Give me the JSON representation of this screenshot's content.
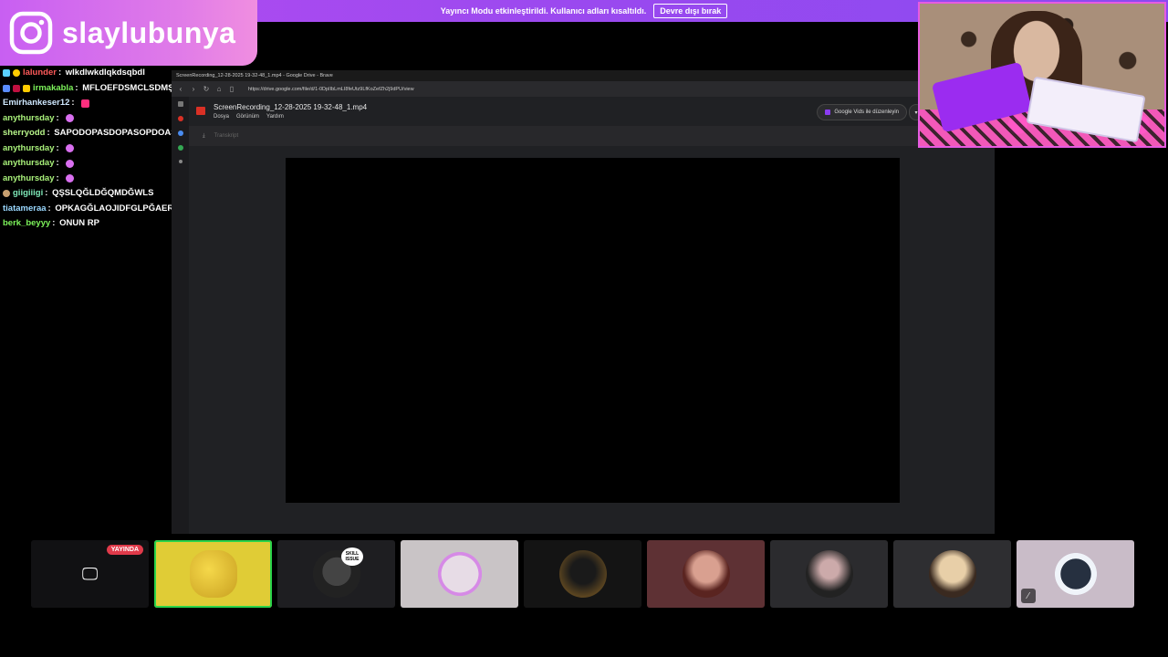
{
  "banner": {
    "message": "Yayıncı Modu etkinleştirildi. Kullanıcı adları kısaltıldı.",
    "disable_label": "Devre dışı bırak"
  },
  "overlay": {
    "instagram_handle": "slaylubunya",
    "icon": "instagram-icon"
  },
  "chat": {
    "messages": [
      {
        "user": "lalunder",
        "text": "wlkdlwkdlqkdsqbdl",
        "user_color": "#ff5a5a"
      },
      {
        "user": "irmakabla",
        "text": "MFLOEFDSMCLSDMŞVLV",
        "user_color": "#7cf25a"
      },
      {
        "user": "Emirhankeser12",
        "text": "",
        "user_color": "#cfe8ff"
      },
      {
        "user": "anythursday",
        "text": "",
        "user_color": "#a8f07a"
      },
      {
        "user": "sherryodd",
        "text": "SAPODOPASDOPASOPDOASOPAPS",
        "user_color": "#b8f58a"
      },
      {
        "user": "anythursday",
        "text": "",
        "user_color": "#a8f07a"
      },
      {
        "user": "anythursday",
        "text": "",
        "user_color": "#a8f07a"
      },
      {
        "user": "anythursday",
        "text": "",
        "user_color": "#a8f07a"
      },
      {
        "user": "giigiiigi",
        "text": "QŞSLQĞLDĞQMDĞWLS",
        "user_color": "#7ee8b8"
      },
      {
        "user": "tiatameraa",
        "text": "OPKAGĞLAOJIDFGLPĞAEROHIKEARGIHAEOKRH",
        "user_color": "#9ad8ff"
      },
      {
        "user": "berk_beyyy",
        "text": "ONUN RP",
        "user_color": "#7cf25a"
      }
    ]
  },
  "browser": {
    "window_title": "ScreenRecording_12-28-2025 19-32-48_1.mp4 - Google Drive - Brave",
    "url": "https://drive.google.com/file/d/1-0DpIIbLmLI8feUtz9LfKoZefZh2j9dPU/view",
    "doc_title": "ScreenRecording_12-28-2025 19-32-48_1.mp4",
    "menu": [
      "Dosya",
      "Görünüm",
      "Yardım"
    ],
    "vids_button": "Google Vids ile düzenleyin",
    "transcript_label": "Transkript"
  },
  "tiles": {
    "live_badge": "YAYINDA",
    "skill_issue": "SKILL ISSUE"
  },
  "colors": {
    "banner": "#9a49ef",
    "active_outline": "#2ad34a",
    "live": "#e03a4a",
    "webcam_border": "#e65be0"
  }
}
